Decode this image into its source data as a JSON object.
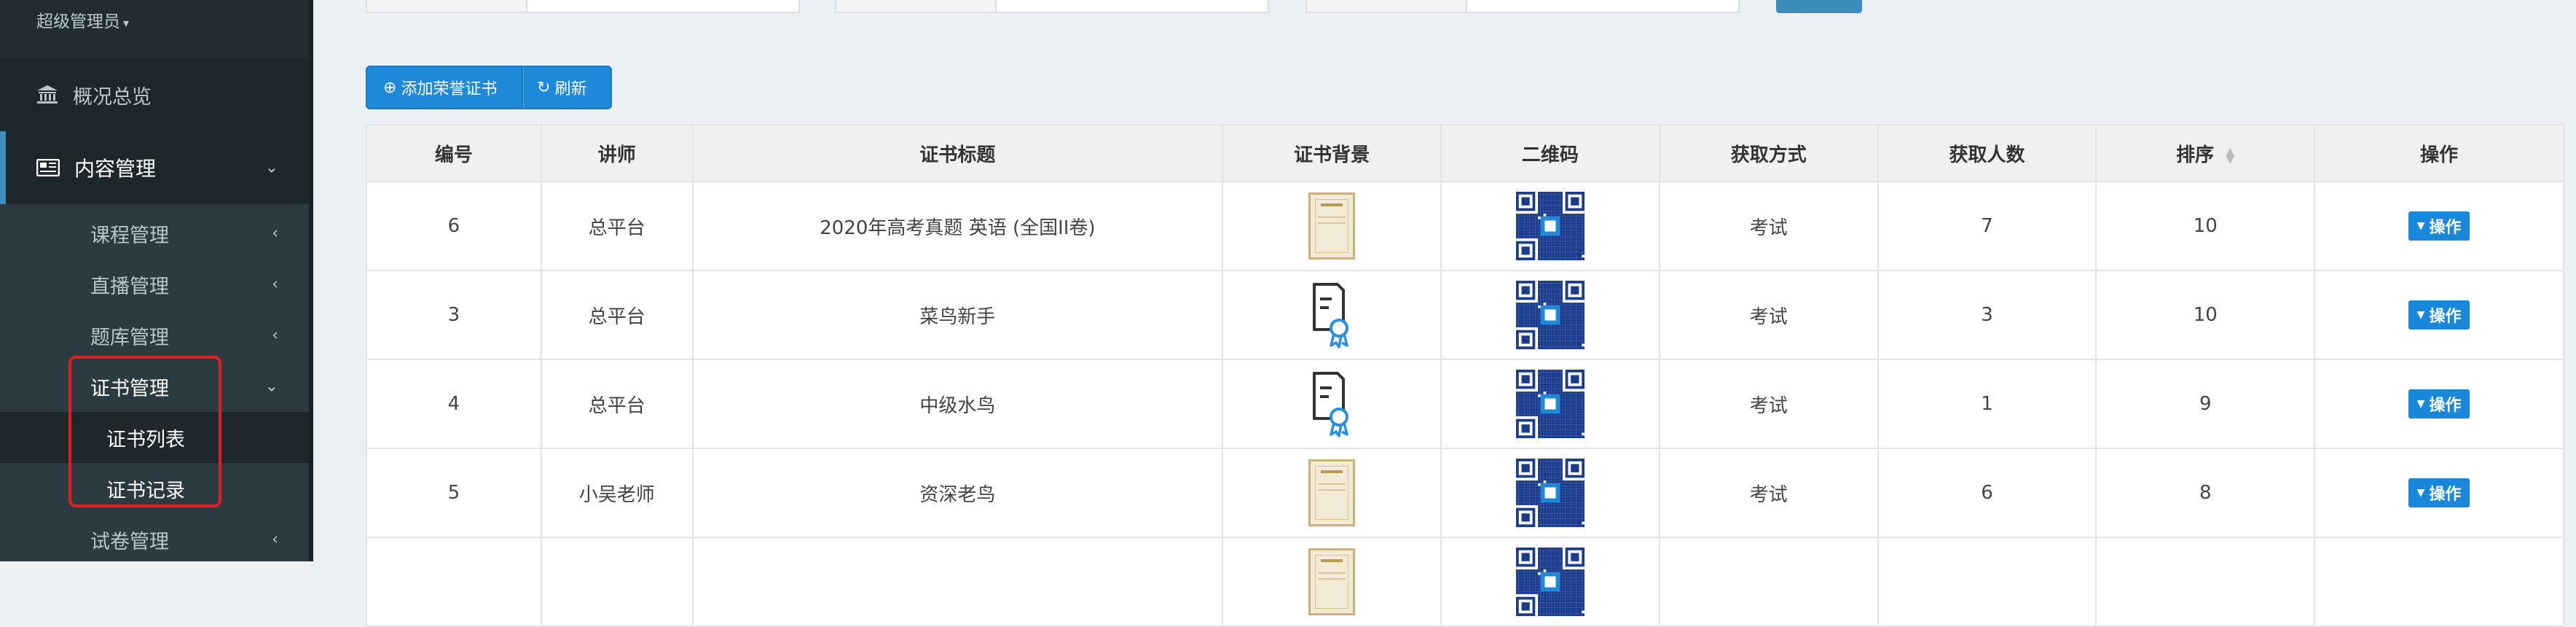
{
  "sidebar": {
    "user_role": "超级管理员",
    "overview": {
      "label": "概况总览",
      "icon": "bank-icon"
    },
    "content": {
      "label": "内容管理",
      "icon": "newspaper-icon"
    },
    "submenu": [
      {
        "label": "课程管理"
      },
      {
        "label": "直播管理"
      },
      {
        "label": "题库管理"
      },
      {
        "label": "证书管理"
      },
      {
        "label": "证书列表"
      },
      {
        "label": "证书记录"
      },
      {
        "label": "试卷管理"
      }
    ]
  },
  "toolbar": {
    "add_label": "添加荣誉证书",
    "refresh_label": "刷新"
  },
  "table": {
    "headers": [
      "编号",
      "讲师",
      "证书标题",
      "证书背景",
      "二维码",
      "获取方式",
      "获取人数",
      "排序",
      "操作"
    ],
    "rows": [
      {
        "id": "6",
        "teacher": "总平台",
        "title": "2020年高考真题 英语 (全国II卷)",
        "background": "certificate-paper",
        "method": "考试",
        "count": "7",
        "sort": "10",
        "op": "操作"
      },
      {
        "id": "3",
        "teacher": "总平台",
        "title": "菜鸟新手",
        "background": "certificate-icon",
        "method": "考试",
        "count": "3",
        "sort": "10",
        "op": "操作"
      },
      {
        "id": "4",
        "teacher": "总平台",
        "title": "中级水鸟",
        "background": "certificate-icon",
        "method": "考试",
        "count": "1",
        "sort": "9",
        "op": "操作"
      },
      {
        "id": "5",
        "teacher": "小吴老师",
        "title": "资深老鸟",
        "background": "certificate-paper",
        "method": "考试",
        "count": "6",
        "sort": "8",
        "op": "操作"
      }
    ]
  },
  "colors": {
    "sidebar_bg": "#222d32",
    "accent": "#1e88d9",
    "highlight_box": "#e02020"
  }
}
